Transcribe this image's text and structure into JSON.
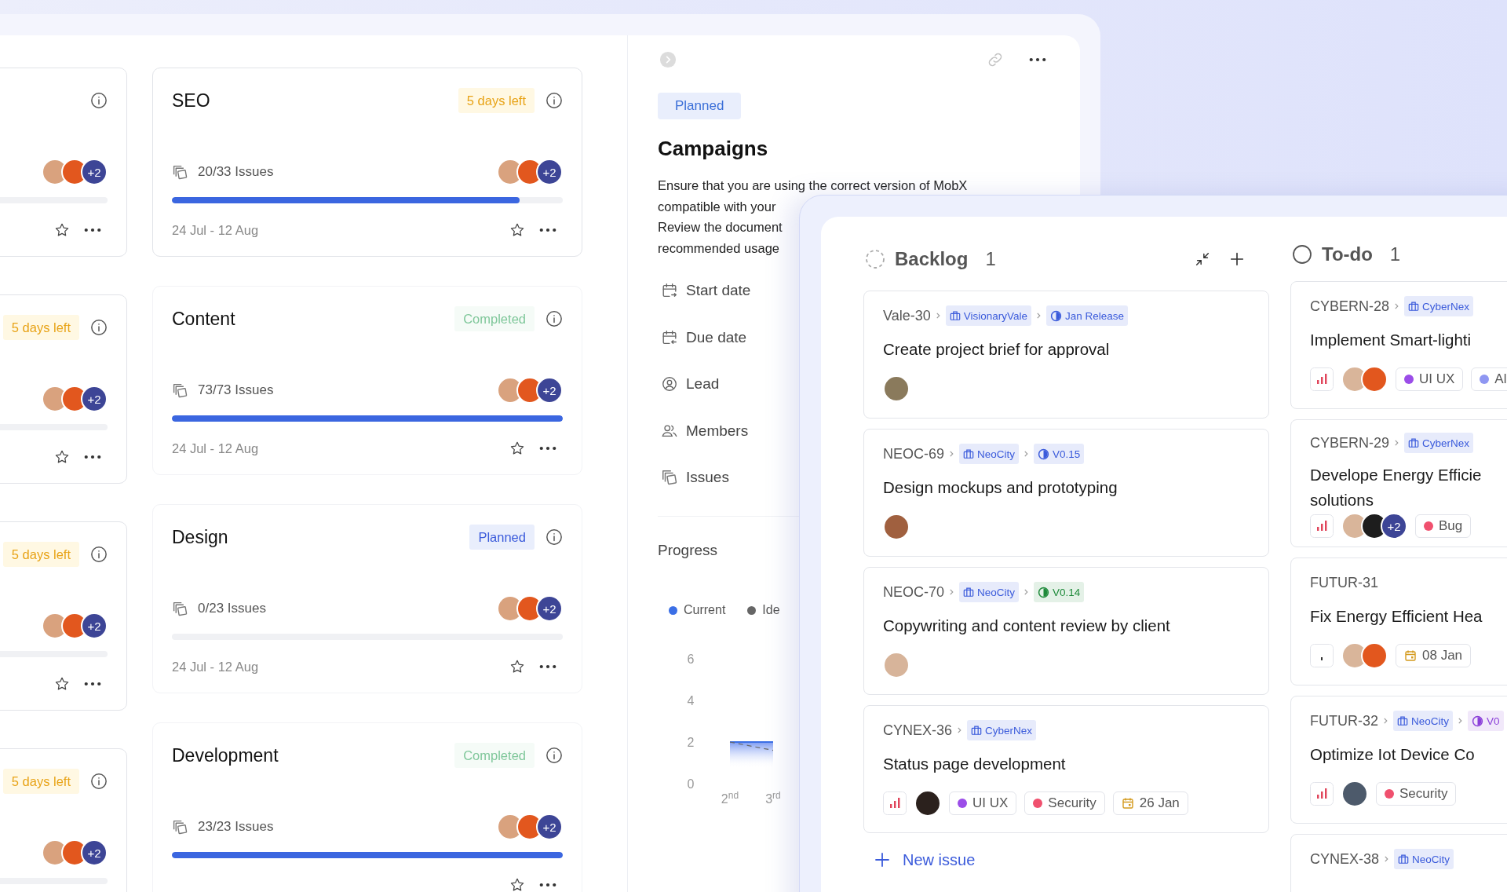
{
  "side_cards": [
    {
      "outlined": true,
      "avatars": [
        {
          "color": "#d9a27e"
        },
        {
          "color": "#e2571e"
        }
      ],
      "more": "+2"
    },
    {
      "outlined": true,
      "badge": {
        "kind": "due",
        "text": "5 days left"
      },
      "avatars": [
        {
          "color": "#d9a27e"
        },
        {
          "color": "#e2571e"
        }
      ],
      "more": "+2"
    },
    {
      "outlined": true,
      "badge": {
        "kind": "due",
        "text": "5 days left"
      },
      "avatars": [
        {
          "color": "#d9a27e"
        },
        {
          "color": "#e2571e"
        }
      ],
      "more": "+2"
    },
    {
      "outlined": true,
      "badge": {
        "kind": "due",
        "text": "5 days left"
      },
      "avatars": [
        {
          "color": "#d9a27e"
        },
        {
          "color": "#e2571e"
        }
      ],
      "more": "+2"
    }
  ],
  "projects": [
    {
      "title": "SEO",
      "outlined": true,
      "badge": {
        "kind": "due",
        "text": "5 days left"
      },
      "issues": "20/33 Issues",
      "level": 0.89,
      "dates": "24 Jul - 12 Aug",
      "avatars": [
        {
          "color": "#d9a27e"
        },
        {
          "color": "#e2571e"
        }
      ],
      "more": "+2"
    },
    {
      "title": "Content",
      "outlined": false,
      "badge": {
        "kind": "completed",
        "text": "Completed"
      },
      "issues": "73/73 Issues",
      "level": 1,
      "dates": "24 Jul - 12 Aug",
      "avatars": [
        {
          "color": "#d9a27e"
        },
        {
          "color": "#e2571e"
        }
      ],
      "more": "+2"
    },
    {
      "title": "Design",
      "outlined": false,
      "badge": {
        "kind": "planned",
        "text": "Planned"
      },
      "issues": "0/23 Issues",
      "level": 0,
      "dates": "24 Jul - 12 Aug",
      "avatars": [
        {
          "color": "#d9a27e"
        },
        {
          "color": "#e2571e"
        }
      ],
      "more": "+2"
    },
    {
      "title": "Development",
      "outlined": false,
      "badge": {
        "kind": "completed",
        "text": "Completed"
      },
      "issues": "23/23 Issues",
      "level": 1,
      "avatars": [
        {
          "color": "#d9a27e"
        },
        {
          "color": "#e2571e"
        }
      ],
      "more": "+2"
    }
  ],
  "detail": {
    "status": "Planned",
    "title": "Campaigns",
    "description": [
      "Ensure that you are using the correct version of MobX",
      "compatible with your",
      "Review the document",
      "recommended usage"
    ],
    "properties": [
      {
        "kind": "start",
        "label": "Start date"
      },
      {
        "kind": "due",
        "label": "Due date"
      },
      {
        "kind": "lead",
        "label": "Lead"
      },
      {
        "kind": "members",
        "label": "Members"
      },
      {
        "kind": "issues",
        "label": "Issues"
      }
    ],
    "progress": {
      "title": "Progress",
      "chart_data": {
        "type": "line",
        "categories": [
          "2$^{nd}$",
          "3$^{rd}$"
        ],
        "ylim": [
          0,
          6
        ],
        "yticks": [
          0,
          2,
          4,
          6
        ],
        "series": [
          {
            "name": "Current",
            "color": "#3b6fe6",
            "line_style": "solid",
            "values": [
              2,
              2
            ]
          },
          {
            "name": "Ide",
            "color": "#666666",
            "line_style": "dashed",
            "values": [
              2,
              1.6
            ]
          }
        ]
      }
    }
  },
  "board": {
    "columns": [
      {
        "kind": "backlog",
        "title": "Backlog",
        "count": "1",
        "actions": true,
        "new_issue": "New issue",
        "cards": [
          {
            "id": "Vale-30",
            "crumbs": [
              {
                "kind": "project",
                "text": "VisionaryVale",
                "color": "#3b5bdb"
              },
              {
                "kind": "cycle",
                "text": "Jan Release",
                "color": "#3b5bdb"
              }
            ],
            "title": "Create project brief for approval",
            "avatars": [
              {
                "color": "#8a7a5c"
              }
            ]
          },
          {
            "id": "NEOC-69",
            "crumbs": [
              {
                "kind": "project",
                "text": "NeoCity",
                "color": "#3b5bdb"
              },
              {
                "kind": "cycle",
                "text": "V0.15",
                "color": "#3b5bdb"
              }
            ],
            "title": "Design mockups and prototyping",
            "avatars": [
              {
                "color": "#a0603f"
              }
            ]
          },
          {
            "id": "NEOC-70",
            "crumbs": [
              {
                "kind": "project",
                "text": "NeoCity",
                "color": "#3b5bdb"
              },
              {
                "kind": "cycle",
                "text": "V0.14",
                "color": "#1e8a3a"
              }
            ],
            "title": "Copywriting and content review by client",
            "avatars": [
              {
                "color": "#d7b49a"
              }
            ]
          },
          {
            "id": "CYNEX-36",
            "crumbs": [
              {
                "kind": "project",
                "text": "CyberNex",
                "color": "#3b5bdb"
              }
            ],
            "title": "Status page development",
            "high_priority": true,
            "avatars": [
              {
                "color": "#2b211d"
              }
            ],
            "labels": [
              {
                "kind": "label",
                "text": "UI UX",
                "color": "#9b4de8"
              },
              {
                "kind": "label",
                "text": "Security",
                "color": "#f0506e"
              },
              {
                "kind": "date",
                "text": "26 Jan"
              }
            ]
          }
        ]
      },
      {
        "kind": "todo",
        "title": "To-do",
        "count": "1",
        "cards": [
          {
            "id": "CYBERN-28",
            "crumbs": [
              {
                "kind": "project",
                "text": "CyberNex",
                "color": "#3b5bdb"
              }
            ],
            "title": "Implement Smart-lighti",
            "high_priority": true,
            "avatars": [
              {
                "color": "#d9b59a"
              },
              {
                "color": "#e2571e"
              }
            ],
            "labels": [
              {
                "kind": "label",
                "text": "UI UX",
                "color": "#9b4de8"
              },
              {
                "kind": "label",
                "text": "Al",
                "color": "#8f97f2"
              }
            ]
          },
          {
            "id": "CYBERN-29",
            "crumbs": [
              {
                "kind": "project",
                "text": "CyberNex",
                "color": "#3b5bdb"
              }
            ],
            "title": "Develope Energy Efficie\nsolutions",
            "high_priority": true,
            "avatars": [
              {
                "color": "#d9b59a"
              },
              {
                "color": "#1d1d1d"
              }
            ],
            "more": "+2",
            "labels": [
              {
                "kind": "label",
                "text": "Bug",
                "color": "#f0506e"
              }
            ]
          },
          {
            "id": "FUTUR-31",
            "title": "Fix Energy Efficient Hea",
            "high_priority": false,
            "avatars": [
              {
                "color": "#d9b59a"
              },
              {
                "color": "#e2571e"
              }
            ],
            "labels": [
              {
                "kind": "date",
                "text": "08 Jan"
              }
            ]
          },
          {
            "id": "FUTUR-32",
            "crumbs": [
              {
                "kind": "project",
                "text": "NeoCity",
                "color": "#3b5bdb"
              },
              {
                "kind": "cycle",
                "text": "V0",
                "color": "#8b3fd9"
              }
            ],
            "title": "Optimize Iot Device Co",
            "high_priority": true,
            "avatars": [
              {
                "color": "#4d5a6b"
              }
            ],
            "labels": [
              {
                "kind": "label",
                "text": "Security",
                "color": "#f0506e"
              }
            ]
          },
          {
            "id": "CYNEX-38",
            "crumbs": [
              {
                "kind": "project",
                "text": "NeoCity",
                "color": "#3b5bdb"
              }
            ]
          }
        ]
      }
    ]
  }
}
